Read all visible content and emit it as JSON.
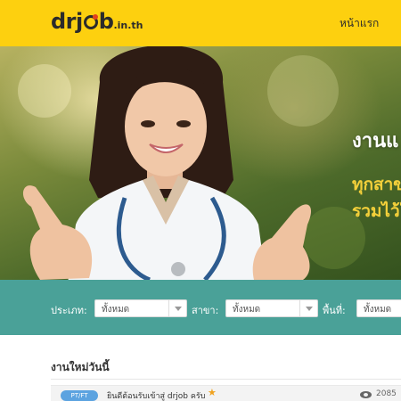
{
  "header": {
    "logo_prefix": "dr",
    "logo_j": "j",
    "logo_suffix": "b",
    "logo_tld": ".in.th",
    "nav_home": "หน้าแรก"
  },
  "hero": {
    "title": "งานแ",
    "line1": "ทุกสาข",
    "line2": "รวมไว้ใ"
  },
  "filters": {
    "type_label": "ประเภท:",
    "type_value": "ทั้งหมด",
    "branch_label": "สาขา:",
    "branch_value": "ทั้งหมด",
    "area_label": "พื้นที่:",
    "area_value": "ทั้งหมด"
  },
  "section": {
    "title": "งานใหม่วันนี้"
  },
  "jobs": [
    {
      "badge": "PT/FT",
      "title": "ยินดีต้อนรับเข้าสู่ drjob ครับ",
      "views": "2085"
    }
  ],
  "colors": {
    "header_bg": "#fdd00f",
    "filter_bg": "#4aa198",
    "accent_red": "#e2421c",
    "badge_blue": "#5ca3e0",
    "star_orange": "#f0a21f"
  }
}
